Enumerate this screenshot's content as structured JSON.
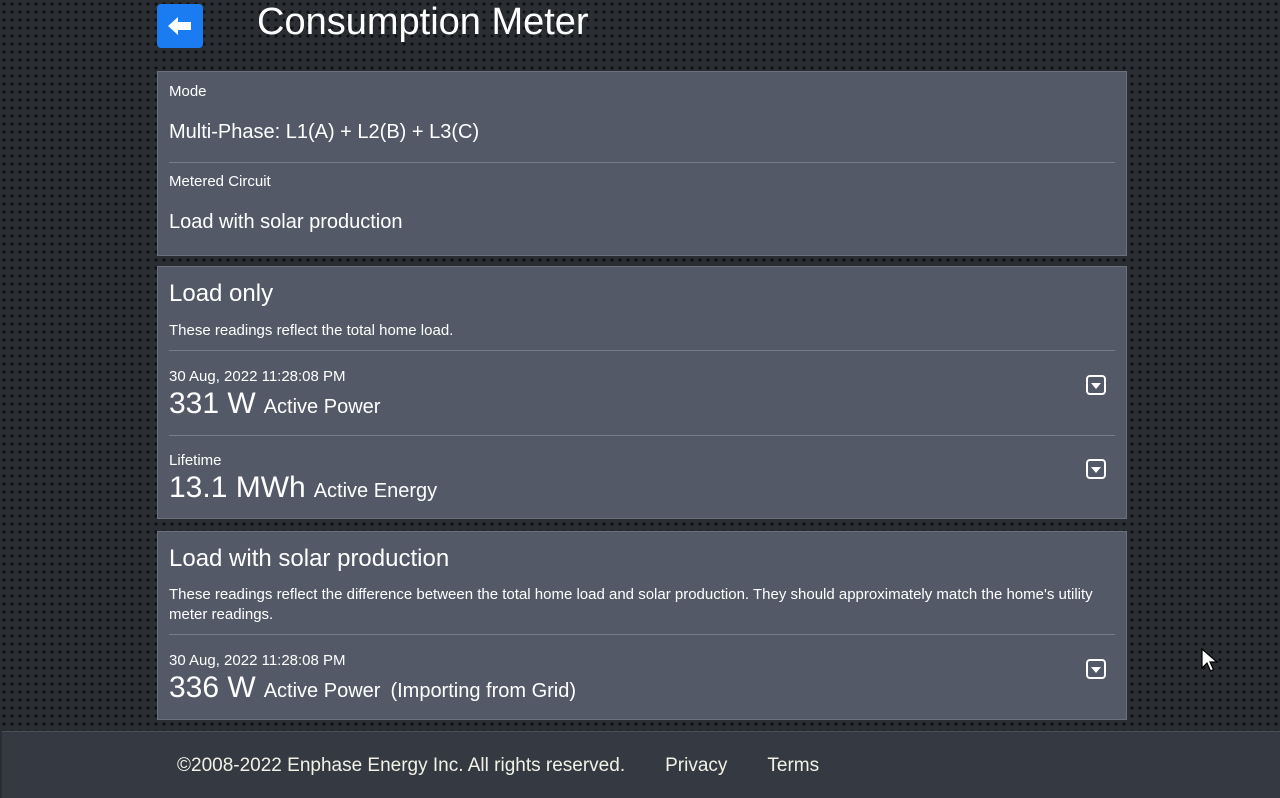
{
  "header": {
    "title": "Consumption Meter",
    "back_icon": "arrow-left-icon"
  },
  "info": {
    "mode_label": "Mode",
    "mode_value": "Multi-Phase: L1(A) + L2(B) + L3(C)",
    "circuit_label": "Metered Circuit",
    "circuit_value": "Load with solar production"
  },
  "load_only": {
    "title": "Load only",
    "description": "These readings reflect the total home load.",
    "power": {
      "timestamp": "30 Aug, 2022 11:28:08 PM",
      "value": "331 W",
      "label": "Active Power"
    },
    "energy": {
      "caption": "Lifetime",
      "value": "13.1 MWh",
      "label": "Active Energy"
    }
  },
  "load_with_solar": {
    "title": "Load with solar production",
    "description": "These readings reflect the difference between the total home load and solar production. They should approximately match the home's utility meter readings.",
    "power": {
      "timestamp": "30 Aug, 2022 11:28:08 PM",
      "value": "336 W",
      "label": "Active Power",
      "note": "(Importing from Grid)"
    }
  },
  "footer": {
    "copyright": "©2008-2022 Enphase Energy Inc. All rights reserved.",
    "privacy": "Privacy",
    "terms": "Terms"
  },
  "colors": {
    "accent": "#1a7cf0",
    "panel": "#535966",
    "footer": "#353a42"
  }
}
